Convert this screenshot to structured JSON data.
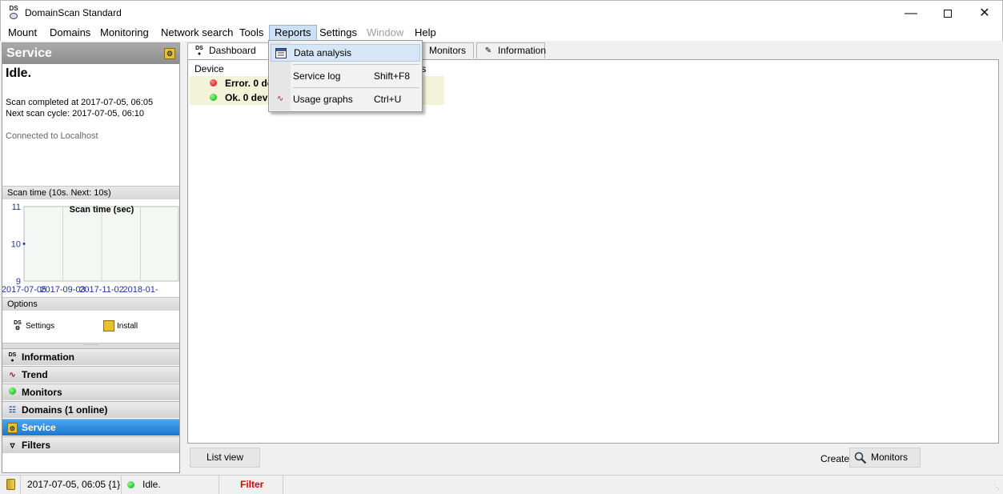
{
  "window": {
    "title": "DomainScan Standard",
    "app_icon_label": "DS"
  },
  "menu": {
    "mount": "Mount",
    "domains": "Domains",
    "monitoring": "Monitoring",
    "network_search": "Network search",
    "tools": "Tools",
    "reports": "Reports",
    "settings": "Settings",
    "window": "Window",
    "help": "Help"
  },
  "reports_menu": {
    "items": [
      {
        "label": "Data analysis",
        "shortcut": "",
        "icon": "table-icon"
      },
      {
        "label": "Service log",
        "shortcut": "Shift+F8",
        "icon": ""
      },
      {
        "label": "Usage graphs",
        "shortcut": "Ctrl+U",
        "icon": "graph-icon"
      }
    ]
  },
  "left_panel": {
    "header": "Service",
    "status": "Idle.",
    "scan_completed": "Scan completed at 2017-07-05, 06:05",
    "next_scan": "Next scan cycle: 2017-07-05, 06:10",
    "connection": "Connected to Localhost",
    "scan_time_label": "Scan time (10s. Next: 10s)",
    "options_label": "Options",
    "option_settings": "Settings",
    "option_install": "Install",
    "splitter_dots": "··········",
    "nav": [
      {
        "label": "Information",
        "icon": "ds-logo-icon",
        "active": false
      },
      {
        "label": "Trend",
        "icon": "trend-icon",
        "active": false
      },
      {
        "label": "Monitors",
        "icon": "green-dot-icon",
        "active": false
      },
      {
        "label": "Domains (1 online)",
        "icon": "network-icon",
        "active": false
      },
      {
        "label": "Service",
        "icon": "service-icon",
        "active": true
      },
      {
        "label": "Filters",
        "icon": "filter-icon",
        "active": false
      }
    ]
  },
  "chart_data": {
    "type": "line",
    "title": "Scan time (sec)",
    "x": [
      "2017-07-05"
    ],
    "x_ticks": [
      "2017-07-05",
      "2017-09-03",
      "2017-11-02",
      "2018-01-"
    ],
    "y_ticks": [
      "11",
      "10",
      "9"
    ],
    "series": [
      {
        "values": [
          10
        ]
      }
    ],
    "ylim": [
      9,
      11
    ],
    "grid": true
  },
  "tabs": {
    "dashboard": "Dashboard",
    "monitors": "Monitors",
    "information": "Information"
  },
  "dashboard": {
    "col_device": "Device",
    "col_actions": "tions",
    "rows": [
      {
        "text": "Error. 0 de",
        "status_color": "#dd0000"
      },
      {
        "text": "Ok. 0 dev",
        "status_color": "#00aa00"
      }
    ]
  },
  "bottom": {
    "list_view": "List view",
    "create_label": "Create:",
    "create_monitors": "Monitors"
  },
  "statusbar": {
    "date": "2017-07-05, 06:05 {1}",
    "status": "Idle.",
    "filter": "Filter"
  },
  "colors": {
    "active_nav": "#1a77cf",
    "filter_text": "#e00000",
    "row_bg": "#f3f3d9"
  }
}
